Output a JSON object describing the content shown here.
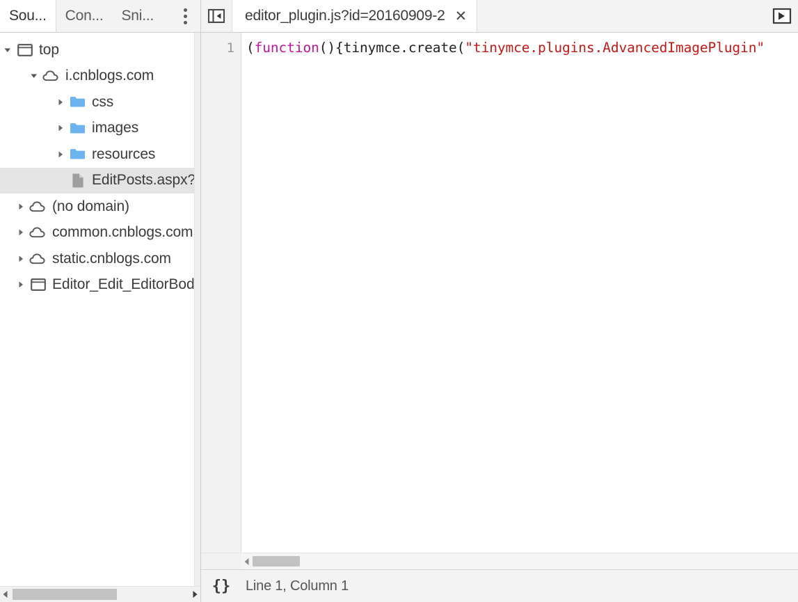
{
  "sidebar": {
    "tabs": [
      {
        "label": "Sou...",
        "name": "tab-sources",
        "selected": true
      },
      {
        "label": "Con...",
        "name": "tab-content-scripts",
        "selected": false
      },
      {
        "label": "Sni...",
        "name": "tab-snippets",
        "selected": false
      }
    ],
    "more_menu_icon": "kebab-menu-icon",
    "tree": [
      {
        "label": "top",
        "icon": "frame-icon",
        "twisty": "expanded",
        "indent": 0,
        "selected": false
      },
      {
        "label": "i.cnblogs.com",
        "icon": "cloud-icon",
        "twisty": "expanded",
        "indent": 1,
        "selected": false
      },
      {
        "label": "css",
        "icon": "folder-icon",
        "twisty": "collapsed",
        "indent": 2,
        "selected": false
      },
      {
        "label": "images",
        "icon": "folder-icon",
        "twisty": "collapsed",
        "indent": 2,
        "selected": false
      },
      {
        "label": "resources",
        "icon": "folder-icon",
        "twisty": "collapsed",
        "indent": 2,
        "selected": false
      },
      {
        "label": "EditPosts.aspx?opt",
        "icon": "file-icon",
        "twisty": "none",
        "indent": 2,
        "selected": true
      },
      {
        "label": "(no domain)",
        "icon": "cloud-icon",
        "twisty": "collapsed",
        "indent": 1,
        "selected": false
      },
      {
        "label": "common.cnblogs.com",
        "icon": "cloud-icon",
        "twisty": "collapsed",
        "indent": 1,
        "selected": false
      },
      {
        "label": "static.cnblogs.com",
        "icon": "cloud-icon",
        "twisty": "collapsed",
        "indent": 1,
        "selected": false
      },
      {
        "label": "Editor_Edit_EditorBod",
        "icon": "frame-icon",
        "twisty": "collapsed",
        "indent": 1,
        "selected": false
      }
    ],
    "hscrollbar": {
      "left_arrow_icon": "scroll-left-arrow-icon",
      "right_arrow_icon": "scroll-right-arrow-icon"
    }
  },
  "editor": {
    "toggle_navigator_icon": "show-navigator-icon",
    "tab": {
      "title": "editor_plugin.js?id=20160909-2",
      "close_label": "✕"
    },
    "next_tab_icon": "tab-next-arrow-icon",
    "gutter": {
      "line_numbers": [
        "1"
      ]
    },
    "code": {
      "line1_tokens": [
        {
          "text": "(",
          "type": "punct"
        },
        {
          "text": "function",
          "type": "keyword"
        },
        {
          "text": "(){",
          "type": "punct"
        },
        {
          "text": "tinymce",
          "type": "plain"
        },
        {
          "text": ".",
          "type": "punct"
        },
        {
          "text": "create",
          "type": "plain"
        },
        {
          "text": "(",
          "type": "punct"
        },
        {
          "text": "\"tinymce.plugins.AdvancedImagePlugin\"",
          "type": "string"
        }
      ]
    },
    "hscrollbar": {
      "left_arrow_icon": "scroll-left-arrow-icon"
    }
  },
  "statusbar": {
    "pretty_print_label": "{}",
    "pretty_print_icon": "pretty-print-icon",
    "position_text": "Line 1, Column 1"
  },
  "colors": {
    "tabbar_bg": "#f3f3f3",
    "selection_bg": "#e4e4e4",
    "folder_blue": "#6cb3f0",
    "keyword_magenta": "#c2179b",
    "string_red": "#c41a16",
    "scrollbar_thumb": "#c2c2c2"
  }
}
